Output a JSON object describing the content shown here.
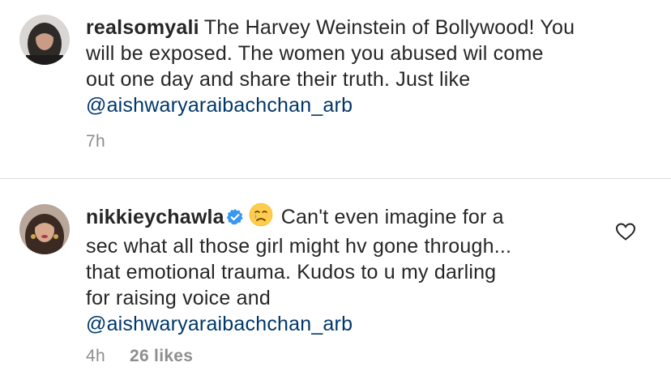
{
  "comments": [
    {
      "username": "realsomyali",
      "text_lines": [
        "The Harvey Weinstein of Bollywood! You",
        "will be exposed. The women you abused wil come",
        "out one day and share their truth. Just like"
      ],
      "mention": "@aishwaryaraibachchan_arb",
      "time": "7h"
    },
    {
      "username": "nikkieychawla",
      "verified": true,
      "emoji": "crying-face",
      "text_lines": [
        "Can't even imagine for a",
        "sec what all those girl might hv gone through...",
        "that emotional trauma. Kudos to u my darling",
        "for raising voice and"
      ],
      "mention": "@aishwaryaraibachchan_arb",
      "time": "4h",
      "likes": "26 likes",
      "like_icon": "heart-outline-icon"
    }
  ],
  "colors": {
    "text": "#262626",
    "mention": "#00376b",
    "meta": "#8e8e8e",
    "verified": "#3897f0",
    "divider": "#dbdbdb"
  }
}
